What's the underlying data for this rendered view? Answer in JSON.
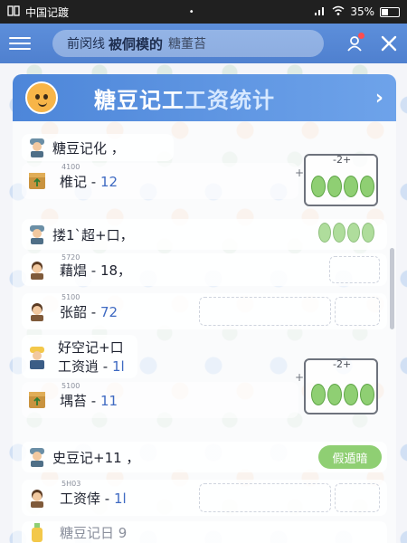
{
  "status_bar": {
    "carrier": "中国记踱",
    "dot": "•",
    "battery": "35%",
    "icons": [
      "signal-icon",
      "wifi-icon",
      "battery-icon"
    ]
  },
  "app_bar": {
    "title_prefix": "前闵线",
    "title_main": "被侗模的",
    "title_suffix": "糖董苔",
    "icons": [
      "menu-icon",
      "user-icon",
      "close-icon"
    ]
  },
  "header": {
    "title_main": "糖豆记工",
    "title_accent": "工资统计",
    "chevron": "›"
  },
  "rows": [
    {
      "label": "糖豆记化 ，",
      "value": ""
    },
    {
      "label": "椎记 - ",
      "value": "12",
      "small": "4100"
    },
    {
      "label": "搂1`超+口，",
      "value": ""
    },
    {
      "label": "藉焻 - 18，",
      "value": "",
      "small": "5720"
    },
    {
      "label": "张韶 - ",
      "value": "72",
      "small": "5100"
    },
    {
      "label": "好空记+口",
      "value": ""
    },
    {
      "label": "工资逍 - ",
      "value": "1l"
    },
    {
      "label": "堣苔 - ",
      "value": "11",
      "small": "5100"
    },
    {
      "label": "史豆记+11 ，",
      "value": ""
    },
    {
      "label": "工资倖 - ",
      "value": "1l",
      "small": "5H03"
    },
    {
      "label": "糖豆记日 9",
      "value": ""
    }
  ],
  "widgets": [
    {
      "label": "-2+"
    },
    {
      "label": "-2+"
    }
  ],
  "green_button": "假遁暗",
  "colors": {
    "app_bar": "#4f80cf",
    "accent_green": "#8fcf73",
    "value_blue": "#3f6ac2"
  }
}
